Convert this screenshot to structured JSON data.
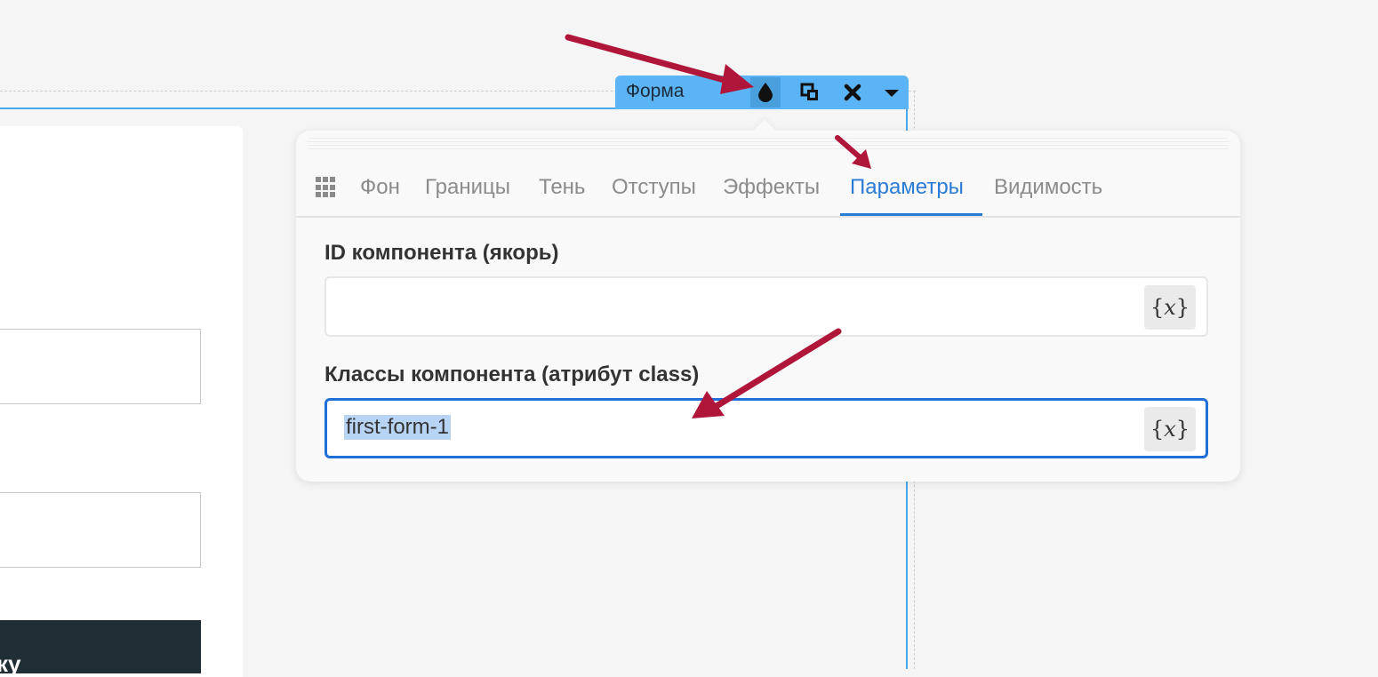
{
  "toolbar": {
    "label": "Форма",
    "buttons": [
      "color-drop-icon",
      "duplicate-icon",
      "close-icon",
      "caret-down-icon"
    ]
  },
  "panel": {
    "tabs": [
      {
        "label": "Фон",
        "active": false
      },
      {
        "label": "Границы",
        "active": false
      },
      {
        "label": "Тень",
        "active": false
      },
      {
        "label": "Отступы",
        "active": false
      },
      {
        "label": "Эффекты",
        "active": false
      },
      {
        "label": "Параметры",
        "active": true
      },
      {
        "label": "Видимость",
        "active": false
      }
    ],
    "fields": {
      "anchor_id": {
        "label": "ID компонента (якорь)",
        "value": ""
      },
      "css_class": {
        "label": "Классы компонента (атрибут class)",
        "value": "first-form-1"
      }
    },
    "variable_button_label": "{𝑥}"
  },
  "form": {
    "submit_label": "ку"
  },
  "colors": {
    "accent": "#2a7bd6",
    "toolbar": "#5ab4f5",
    "annotation_arrow": "#b0163a",
    "selection": "#b8d4f5"
  }
}
